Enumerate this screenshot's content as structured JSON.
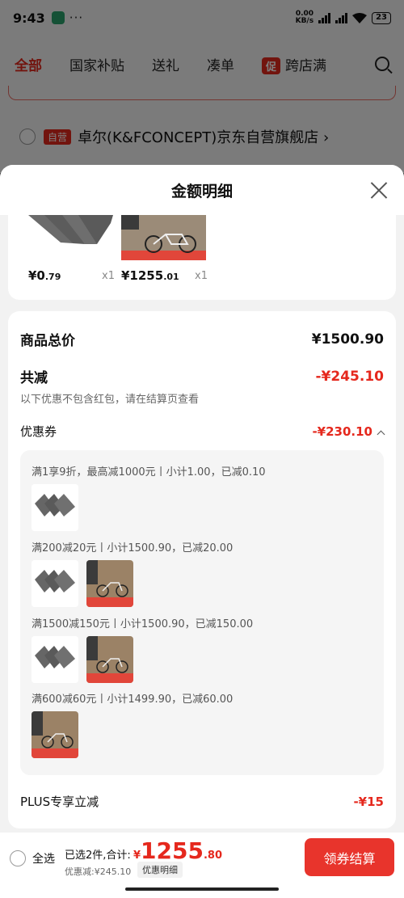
{
  "status_bar": {
    "time": "9:43",
    "net_speed": "0.00",
    "net_unit": "KB/s",
    "battery": "23"
  },
  "nav_tabs": [
    {
      "label": "全部"
    },
    {
      "label": "国家补贴"
    },
    {
      "label": "送礼"
    },
    {
      "label": "凑单"
    },
    {
      "label": "跨店满"
    }
  ],
  "promo_badge": "促",
  "shop": {
    "tag": "自营",
    "name": "卓尔(K&FCONCEPT)京东自营旗舰店 ›"
  },
  "sheet": {
    "title": "金额明细",
    "products": [
      {
        "price_int": "¥0",
        "price_dec": ".79",
        "qty": "x1",
        "image": "gray-cloth"
      },
      {
        "price_int": "¥1255",
        "price_dec": ".01",
        "qty": "x1",
        "image": "bike-poster"
      }
    ],
    "summary": {
      "total_label": "商品总价",
      "total_value": "¥1500.90",
      "reduce_label": "共减",
      "reduce_value": "-¥245.10",
      "note": "以下优惠不包含红包，请在结算页查看",
      "coupon_label": "优惠券",
      "coupon_value": "-¥230.10",
      "plus_label": "PLUS专享立减",
      "plus_value": "-¥15"
    },
    "coupons": [
      {
        "text": "满1享9折，最高减1000元丨小计1.00，已减0.10",
        "images": [
          "gray-cloth"
        ]
      },
      {
        "text": "满200减20元丨小计1500.90，已减20.00",
        "images": [
          "gray-cloth",
          "bike-poster"
        ]
      },
      {
        "text": "满1500减150元丨小计1500.90，已减150.00",
        "images": [
          "gray-cloth",
          "bike-poster"
        ]
      },
      {
        "text": "满600减60元丨小计1499.90，已减60.00",
        "images": [
          "bike-poster"
        ]
      }
    ]
  },
  "bottom_bar": {
    "select_all": "全选",
    "selected_text": "已选2件,合计:",
    "currency": "¥",
    "total_int": "1255",
    "total_dec": ".80",
    "discount_text": "优惠减:¥245.10",
    "detail_link": "优惠明细",
    "checkout_label": "领券结算"
  },
  "colors": {
    "accent_red": "#e5281d",
    "checkout_red": "#e8342c"
  }
}
